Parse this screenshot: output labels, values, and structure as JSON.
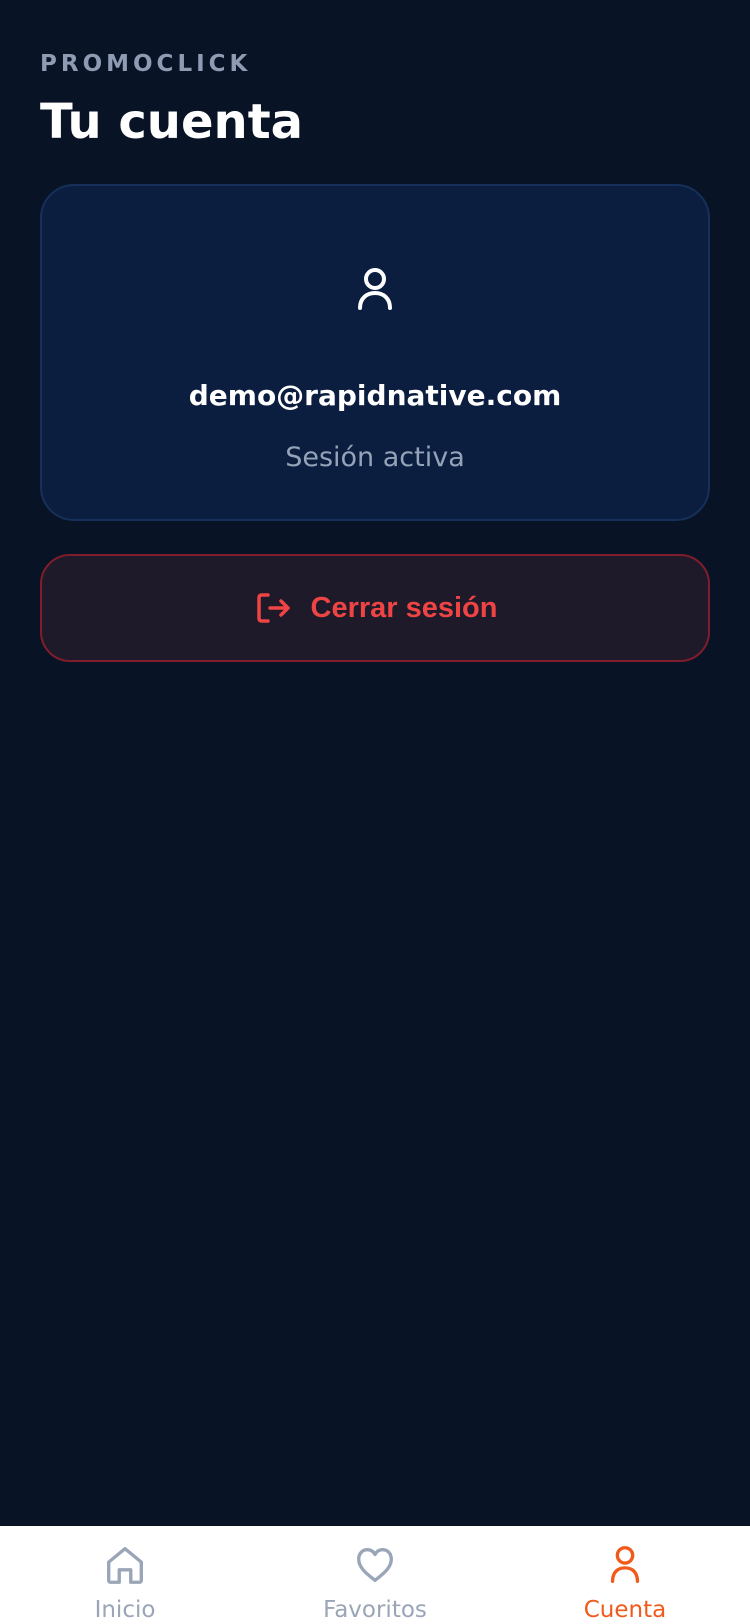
{
  "header": {
    "brand": "PROMOCLICK",
    "title": "Tu cuenta"
  },
  "profile": {
    "email": "demo@rapidnative.com",
    "status": "Sesión activa"
  },
  "actions": {
    "logout_label": "Cerrar sesión"
  },
  "nav": {
    "items": [
      {
        "label": "Inicio",
        "icon": "home-icon",
        "active": false
      },
      {
        "label": "Favoritos",
        "icon": "heart-icon",
        "active": false
      },
      {
        "label": "Cuenta",
        "icon": "user-icon",
        "active": true
      }
    ]
  },
  "colors": {
    "background": "#081326",
    "card": "#0b1e3f",
    "danger": "#ef4444",
    "accent": "#f05a1a",
    "muted": "#94a3b8"
  }
}
